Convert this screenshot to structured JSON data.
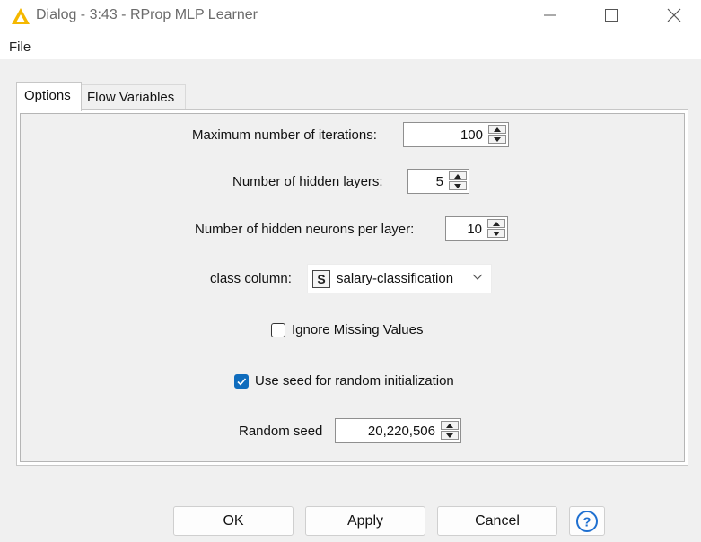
{
  "window": {
    "title": "Dialog - 3:43 - RProp MLP Learner",
    "icon": "knime-warning-triangle-icon",
    "controls": [
      "minimize-icon",
      "maximize-icon",
      "close-icon"
    ]
  },
  "menu": {
    "file_label": "File"
  },
  "tabs": [
    {
      "label": "Options",
      "selected": true
    },
    {
      "label": "Flow Variables",
      "selected": false
    }
  ],
  "options": {
    "max_iterations": {
      "label": "Maximum number of iterations:",
      "value": "100"
    },
    "hidden_layers": {
      "label": "Number of hidden layers:",
      "value": "5"
    },
    "hidden_neurons": {
      "label": "Number of hidden neurons per layer:",
      "value": "10"
    },
    "class_column": {
      "label": "class column:",
      "type_badge": "S",
      "value": "salary-classification"
    },
    "ignore_missing": {
      "label": "Ignore Missing Values",
      "checked": false
    },
    "use_seed": {
      "label": "Use seed for random initialization",
      "checked": true
    },
    "random_seed": {
      "label": "Random seed",
      "value": "20,220,506"
    }
  },
  "buttons": {
    "ok": "OK",
    "apply": "Apply",
    "cancel": "Cancel",
    "help": "?"
  },
  "colors": {
    "accent": "#0f6cbd",
    "warning_icon": "#f5b800",
    "panel_border": "#b5b5b5"
  }
}
